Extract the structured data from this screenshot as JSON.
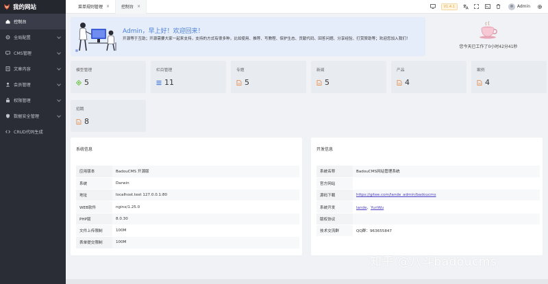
{
  "brand": {
    "name": "我的网站"
  },
  "sidebar": {
    "items": [
      {
        "label": "控制台",
        "icon": "home-icon",
        "active": true,
        "chevron": false
      },
      {
        "label": "全局配置",
        "icon": "gear-icon",
        "active": false,
        "chevron": true
      },
      {
        "label": "CMS管理",
        "icon": "chat-icon",
        "active": false,
        "chevron": true
      },
      {
        "label": "文章内容",
        "icon": "doc-icon",
        "active": false,
        "chevron": true
      },
      {
        "label": "会员管理",
        "icon": "user-icon",
        "active": false,
        "chevron": true
      },
      {
        "label": "权限管理",
        "icon": "lock-icon",
        "active": false,
        "chevron": true
      },
      {
        "label": "数据安全管理",
        "icon": "shield-icon",
        "active": false,
        "chevron": true
      },
      {
        "label": "CRUD代码生成",
        "icon": "code-icon",
        "active": false,
        "chevron": false
      }
    ]
  },
  "tabs": [
    {
      "label": "菜单规则管理",
      "close": "×"
    },
    {
      "label": "控制台",
      "close": "×"
    }
  ],
  "toolbar": {
    "version": "V1.4.1",
    "user": "Admin"
  },
  "welcome": {
    "title": "Admin，早上好！欢迎回来！",
    "text": "开源等于互助；开源需要大家一起来支持，支持的方式有很多种，比如使用、推荐、写教程、保护生态、贡献代码、回答问题、分享经验、打赏赞助等；欢迎您加入我们！"
  },
  "worktime": {
    "text": "您今天已工作了0小时42分41秒"
  },
  "stats": [
    {
      "label": "模型管理",
      "value": "5",
      "icon": "model-icon",
      "color": "#67c23a"
    },
    {
      "label": "栏目管理",
      "value": "11",
      "icon": "list-icon",
      "color": "#4a7fd6"
    },
    {
      "label": "专题",
      "value": "5",
      "icon": "file-icon",
      "color": "#e6853c"
    },
    {
      "label": "新闻",
      "value": "5",
      "icon": "file-icon",
      "color": "#e6853c"
    },
    {
      "label": "产品",
      "value": "4",
      "icon": "file-icon",
      "color": "#e6853c"
    },
    {
      "label": "案例",
      "value": "4",
      "icon": "file-icon",
      "color": "#e6853c"
    },
    {
      "label": "招聘",
      "value": "8",
      "icon": "file-icon",
      "color": "#e6853c"
    }
  ],
  "system_info": {
    "title": "系统信息",
    "rows": [
      {
        "k": "应用版本",
        "v": "BadouCMS 开源版"
      },
      {
        "k": "系统",
        "v": "Darwin"
      },
      {
        "k": "地址",
        "v": "localhost.test 127.0.0.1:80"
      },
      {
        "k": "WEB软件",
        "v": "nginx/1.25.0"
      },
      {
        "k": "PHP版",
        "v": "8.0.30"
      },
      {
        "k": "文件上传限制",
        "v": "100M"
      },
      {
        "k": "表单提交限制",
        "v": "100M"
      }
    ]
  },
  "dev_info": {
    "title": "开发信息",
    "rows": [
      {
        "k": "系统名称",
        "v": "BadouCMS网站管理系统"
      },
      {
        "k": "官方网站",
        "v": ""
      },
      {
        "k": "源码下载",
        "v": "https://gitee.com/lande_admin/badoucms"
      },
      {
        "k": "系统开发",
        "v": ""
      },
      {
        "k": "版权协议",
        "v": ""
      },
      {
        "k": "技术交流群",
        "v": "QQ群：963655847"
      }
    ],
    "devs": {
      "a": "lande",
      "sep": "、",
      "b": "YuriWu"
    }
  },
  "watermark": "知乎 @八斗badoucms"
}
